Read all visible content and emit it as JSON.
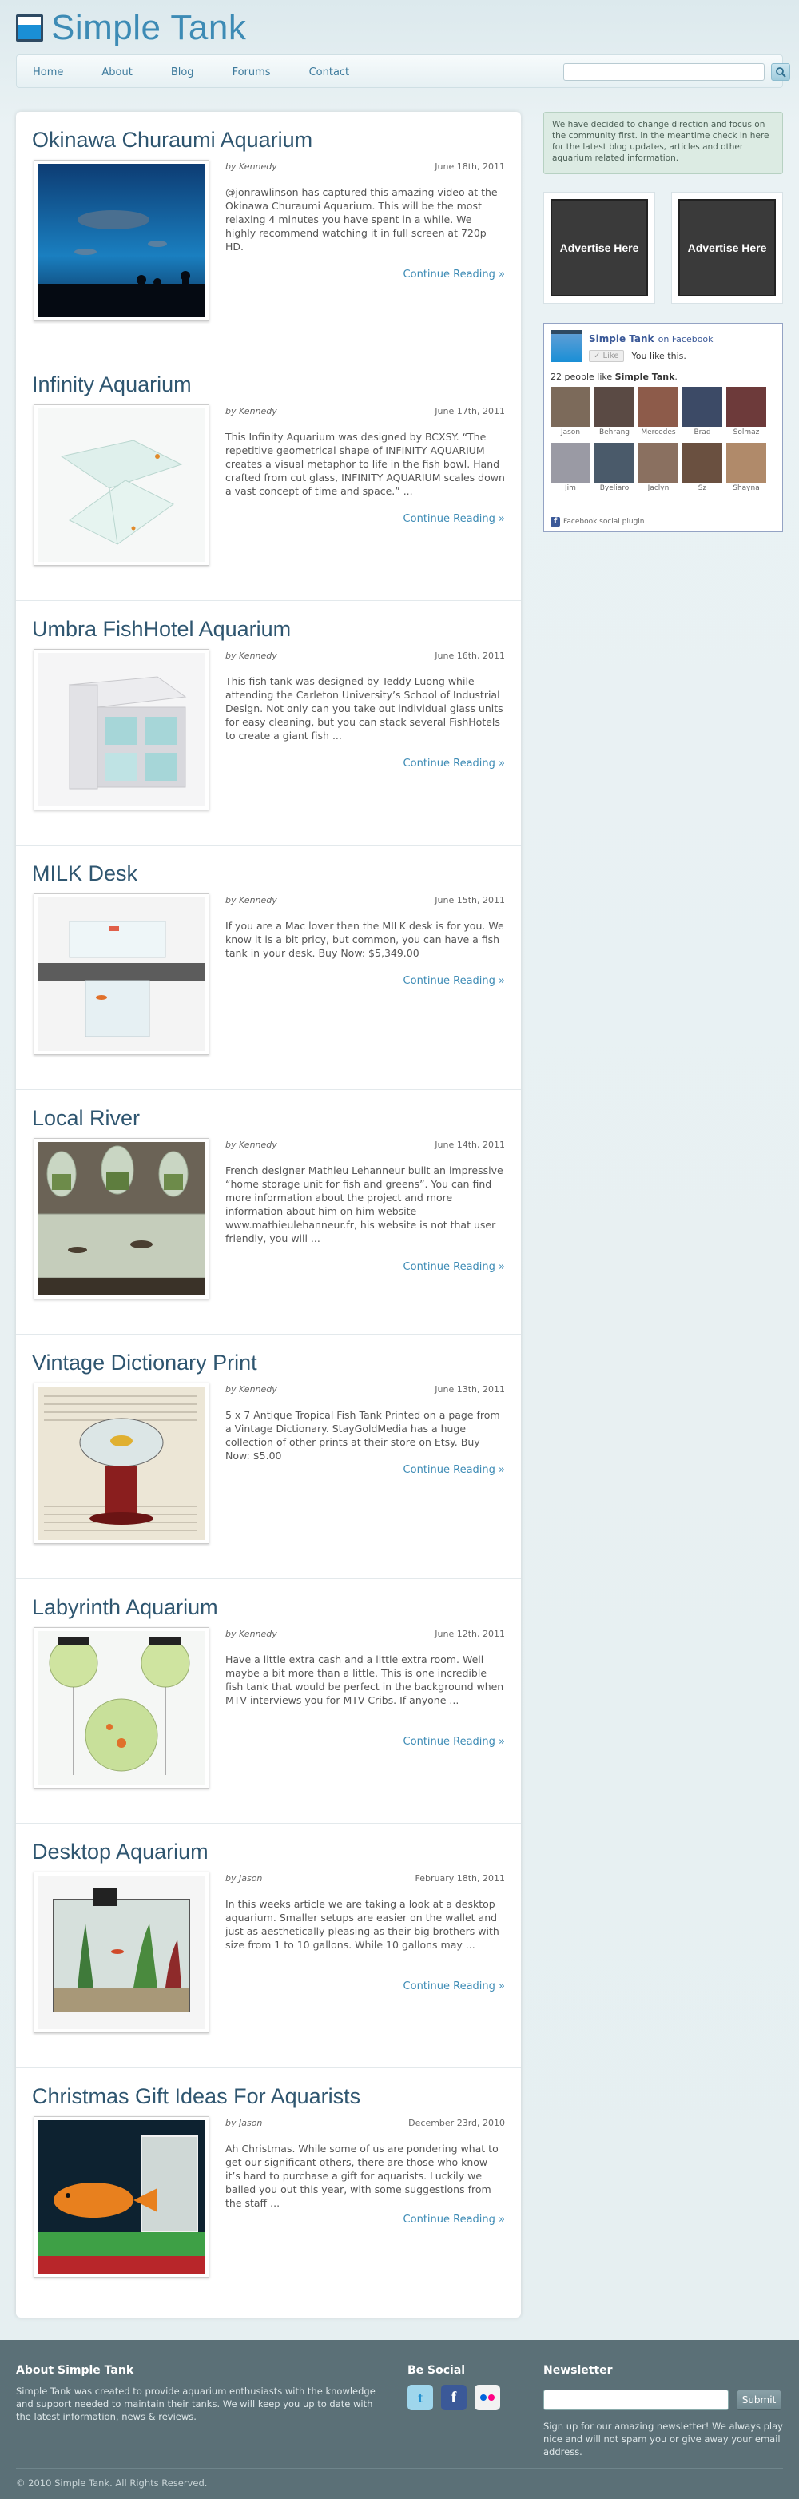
{
  "header": {
    "logo_text": "Simple Tank",
    "nav": [
      "Home",
      "About",
      "Blog",
      "Forums",
      "Contact"
    ],
    "search_placeholder": ""
  },
  "posts": [
    {
      "title": "Okinawa Churaumi Aquarium",
      "author": "by Kennedy",
      "date": "June 18th, 2011",
      "excerpt": "@jonrawlinson has captured this amazing video at the Okinawa Churaumi Aquarium. This will be the most relaxing 4 minutes you have spent in a while. We highly recommend watching it in full screen at 720p HD.",
      "read_more": "Continue Reading »"
    },
    {
      "title": "Infinity Aquarium",
      "author": "by Kennedy",
      "date": "June 17th, 2011",
      "excerpt": "This Infinity Aquarium was designed by BCXSY. “The repetitive geometrical shape of INFINITY AQUARIUM creates a visual metaphor to life in the fish bowl. Hand crafted from cut glass, INFINITY AQUARIUM scales down a vast concept of time and space.” ...",
      "read_more": "Continue Reading »"
    },
    {
      "title": "Umbra FishHotel Aquarium",
      "author": "by Kennedy",
      "date": "June 16th, 2011",
      "excerpt": "This fish tank was designed by Teddy Luong while attending the Carleton University’s School of Industrial Design. Not only can you take out individual glass units for easy cleaning, but you can stack several FishHotels to create a giant fish ...",
      "read_more": "Continue Reading »"
    },
    {
      "title": "MILK Desk",
      "author": "by Kennedy",
      "date": "June 15th, 2011",
      "excerpt": "If you are a Mac lover then the MILK desk is for you. We know it is a bit pricy, but common, you can have a fish tank in your desk. Buy Now: $5,349.00",
      "read_more": "Continue Reading »"
    },
    {
      "title": "Local River",
      "author": "by Kennedy",
      "date": "June 14th, 2011",
      "excerpt": "French designer Mathieu Lehanneur built an impressive “home storage unit for fish and greens”. You can find more information about the project and more information about him on him website www.mathieulehanneur.fr, his website is not that user friendly, you will ...",
      "read_more": "Continue Reading »"
    },
    {
      "title": "Vintage Dictionary Print",
      "author": "by Kennedy",
      "date": "June 13th, 2011",
      "excerpt": "5 x 7 Antique Tropical Fish Tank Printed on a page from a Vintage Dictionary. StayGoldMedia has a huge collection of other prints at their store on Etsy. Buy Now: $5.00",
      "read_more": "Continue Reading »"
    },
    {
      "title": "Labyrinth Aquarium",
      "author": "by Kennedy",
      "date": "June 12th, 2011",
      "excerpt": "Have a little extra cash and a little extra room. Well maybe a bit more than a little. This is one incredible fish tank that would be perfect in the background when MTV interviews you for MTV Cribs. If anyone ...",
      "read_more": "Continue Reading »"
    },
    {
      "title": "Desktop Aquarium",
      "author": "by Jason",
      "date": "February 18th, 2011",
      "excerpt": "In this weeks article we are taking a look at a desktop aquarium. Smaller setups are easier on the wallet and just as aesthetically pleasing as their big brothers with size from 1 to 10 gallons. While 10 gallons may ...",
      "read_more": "Continue Reading »"
    },
    {
      "title": "Christmas Gift Ideas For Aquarists",
      "author": "by Jason",
      "date": "December 23rd, 2010",
      "excerpt": "Ah Christmas. While some of us are pondering what to get our significant others, there are those who know it’s hard to purchase a gift for aquarists. Luckily we bailed you out this year, with some suggestions from the staff ...",
      "read_more": "Continue Reading »"
    }
  ],
  "sidebar": {
    "notice": "We have decided to change direction and focus on the community first. In the meantime check in here for the latest blog updates, articles and other aquarium related information.",
    "ads": [
      "Advertise Here",
      "Advertise Here"
    ],
    "facebook": {
      "page_name": "Simple Tank",
      "on_text": "on Facebook",
      "like_label": "✓ Like",
      "like_status": "You like this.",
      "count_prefix": "22 people like ",
      "count_name": "Simple Tank",
      "count_suffix": ".",
      "faces": [
        "Jason",
        "Behrang",
        "Mercedes",
        "Brad",
        "Solmaz",
        "Jim",
        "Byeliaro",
        "Jaclyn",
        "Sz",
        "Shayna"
      ],
      "face_colors": [
        "#7c6a5a",
        "#5a4a44",
        "#8d5b4a",
        "#3c4a66",
        "#6d3a3a",
        "#9a9aa4",
        "#4a5a6a",
        "#8a7060",
        "#6a5040",
        "#b08a6a"
      ],
      "plugin_label": "Facebook social plugin"
    }
  },
  "footer": {
    "about_title": "About Simple Tank",
    "about_text": "Simple Tank was created to provide aquarium enthusiasts with the knowledge and support needed to maintain their tanks. We will keep you up to date with the latest information, news & reviews.",
    "social_title": "Be Social",
    "newsletter_title": "Newsletter",
    "newsletter_button": "Submit",
    "newsletter_text": "Sign up for our amazing newsletter! We always play nice and will not spam you or give away your email address.",
    "copyright": "© 2010 Simple Tank. All Rights Reserved."
  }
}
